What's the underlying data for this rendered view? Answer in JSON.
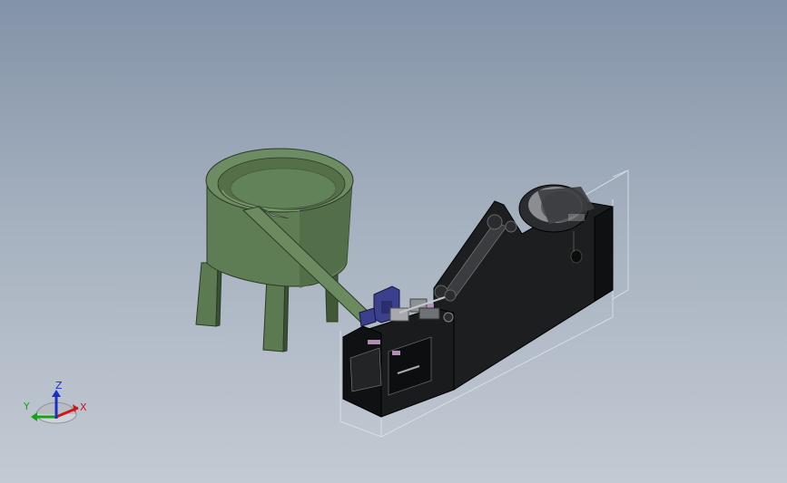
{
  "viewport": {
    "background_top": "#8393a8",
    "background_bottom": "#c3cad3"
  },
  "model": {
    "bowl_color": "#5b7a52",
    "machine_color": "#1c1e20",
    "accent_blue": "#3c3f8c",
    "accent_pink": "#b58ab8"
  },
  "triad": {
    "x_label": "X",
    "y_label": "Y",
    "z_label": "Z",
    "x_color": "#d01818",
    "y_color": "#18a018",
    "z_color": "#1830c8"
  }
}
